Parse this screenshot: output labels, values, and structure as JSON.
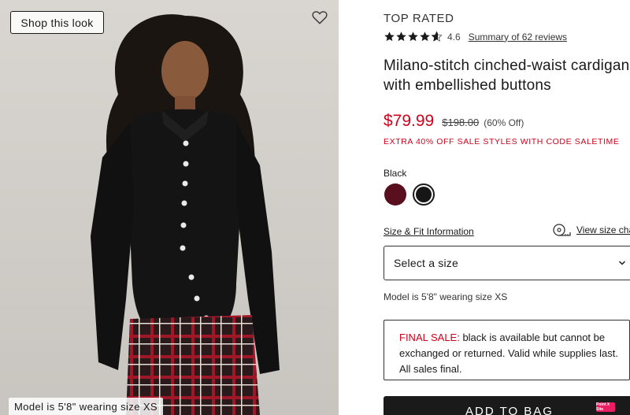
{
  "hero": {
    "shop_look_label": "Shop this look",
    "model_caption": "Model is 5'8\" wearing size XS",
    "fav_icon": "heart-outline-icon"
  },
  "product": {
    "badge": "TOP RATED",
    "rating": "4.6",
    "rating_value": 4.6,
    "rating_max": 5,
    "reviews_link": "Summary of 62 reviews",
    "title": "Milano-stitch cinched-waist cardigan with embellished buttons",
    "sale_price": "$79.99",
    "original_price": "$198.00",
    "percent_off": "(60% Off)",
    "promo": "EXTRA 40% OFF SALE STYLES WITH CODE SALETIME",
    "selected_color": "Black",
    "swatches": [
      {
        "name": "Burgundy",
        "color": "#5a0f1f",
        "selected": false
      },
      {
        "name": "Black",
        "color": "#161616",
        "selected": true
      }
    ],
    "fit_link": "Size & Fit Information",
    "size_chart_link": "View size cha",
    "size_select_placeholder": "Select a size",
    "model_note": "Model is 5'8\" wearing size XS",
    "final_sale_label": "FINAL SALE:",
    "final_sale_text": " black is available but cannot be exchanged or returned. Valid while supplies last. All sales final.",
    "add_to_bag": "ADD TO BAG"
  },
  "colors": {
    "sale_red": "#d0021b",
    "text": "#1a1a1a",
    "button_bg": "#1a1a1a"
  },
  "badge_text": "Point X Site"
}
